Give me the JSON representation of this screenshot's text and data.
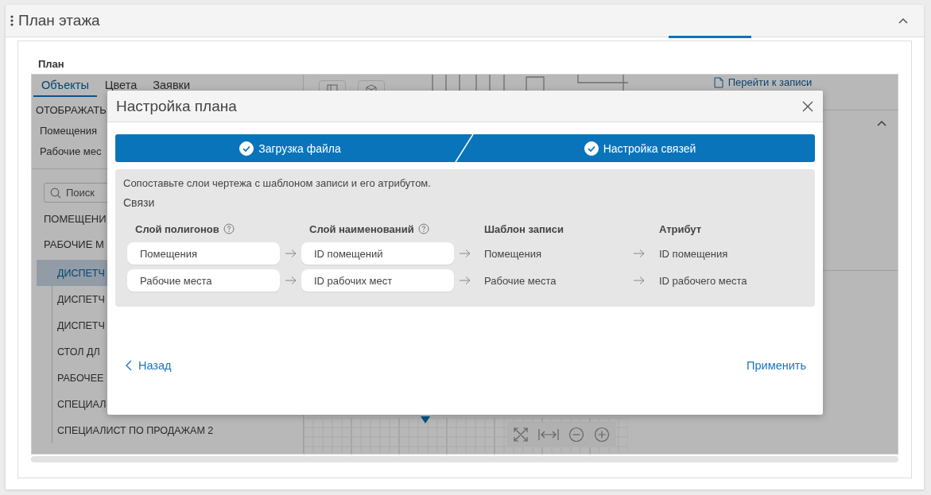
{
  "panel": {
    "title": "План этажа",
    "expanded": true
  },
  "section": {
    "label": "План"
  },
  "plan": {
    "tabs": [
      {
        "label": "Объекты",
        "selected": true
      },
      {
        "label": "Цвета",
        "selected": false
      },
      {
        "label": "Заявки",
        "selected": false
      }
    ],
    "display_heading": "ОТОБРАЖАТЬ",
    "display_items": [
      "Помещения",
      "Рабочие мес"
    ],
    "search": {
      "placeholder": "Поиск"
    },
    "tree": [
      {
        "label": "ПОМЕЩЕНИ",
        "selected": false
      },
      {
        "label": "РАБОЧИЕ М",
        "selected": false,
        "children": [
          {
            "label": "ДИСПЕТЧ",
            "selected": true
          },
          {
            "label": "ДИСПЕТЧ",
            "selected": false
          },
          {
            "label": "ДИСПЕТЧ",
            "selected": false
          },
          {
            "label": "СТОЛ ДЛ",
            "selected": false
          },
          {
            "label": "РАБОЧЕЕ",
            "selected": false
          },
          {
            "label": "СПЕЦИАЛ",
            "selected": false
          },
          {
            "label": "СПЕЦИАЛИСТ ПО ПРОДАЖАМ 2",
            "selected": false
          }
        ]
      }
    ],
    "record_link": "Перейти к записи",
    "details_expanded": true
  },
  "dialog": {
    "title": "Настройка плана",
    "steps": [
      {
        "label": "Загрузка файла",
        "completed": true
      },
      {
        "label": "Настройка связей",
        "completed": true
      }
    ],
    "description": "Сопоставьте слои чертежа с шаблоном записи и его атрибутом.",
    "links_label": "Связи",
    "columns": [
      {
        "label": "Слой полигонов",
        "help": true
      },
      {
        "label": "Слой наименований",
        "help": true
      },
      {
        "label": "Шаблон записи",
        "help": false
      },
      {
        "label": "Атрибут",
        "help": false
      }
    ],
    "rows": [
      {
        "polygon_layer": "Помещения",
        "name_layer": "ID помещений",
        "template": "Помещения",
        "attribute": "ID помещения"
      },
      {
        "polygon_layer": "Рабочие места",
        "name_layer": "ID рабочих мест",
        "template": "Рабочие места",
        "attribute": "ID рабочего места"
      }
    ],
    "back": "Назад",
    "apply": "Применить"
  }
}
